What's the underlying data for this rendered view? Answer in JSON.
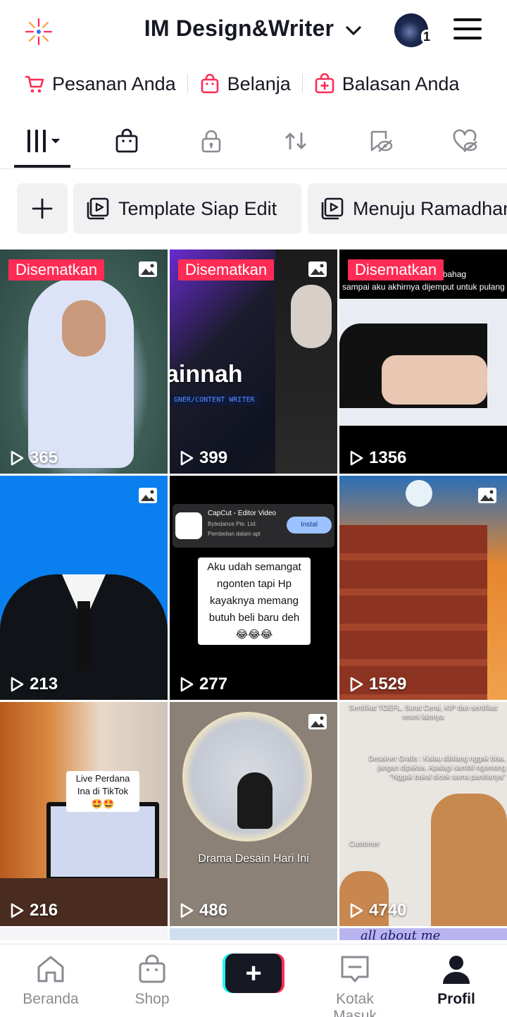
{
  "header": {
    "account_name": "IM Design&Writer",
    "notification_count": "1",
    "icons": [
      "sparkle-icon",
      "chevron-down-icon",
      "avatar",
      "hamburger-menu-icon"
    ]
  },
  "quick_links": [
    {
      "label": "Pesanan Anda",
      "icon": "cart-icon"
    },
    {
      "label": "Belanja",
      "icon": "shopping-bag-icon"
    },
    {
      "label": "Balasan Anda",
      "icon": "add-reply-icon"
    }
  ],
  "tabs": [
    "grid-icon",
    "shop-bag-icon",
    "lock-icon",
    "repost-icon",
    "favorites-icon",
    "liked-icon"
  ],
  "playlists": {
    "add_icon": "plus-icon",
    "items": [
      {
        "label": "Template Siap Edit"
      },
      {
        "label": "Menuju Ramadhan"
      }
    ]
  },
  "grid": {
    "pinned_label": "Disematkan",
    "cells": [
      {
        "views": "365",
        "pinned": true,
        "photo": true
      },
      {
        "views": "399",
        "pinned": true,
        "photo": true,
        "text1": "ainnah",
        "text2": "GNER/CONTENT WRITER"
      },
      {
        "views": "1356",
        "pinned": true,
        "photo": false,
        "text1": "berakhir bahag",
        "text2": "sampai aku akhirnya dijemput untuk pulang"
      },
      {
        "views": "213",
        "pinned": false,
        "photo": true
      },
      {
        "views": "277",
        "pinned": false,
        "photo": false,
        "app_name": "CapCut - Editor Video",
        "app_dev": "Bytedance Pte. Ltd.",
        "app_note": "Pembelian dalam apl",
        "install": "Instal",
        "caption": "Aku udah semangat ngonten tapi Hp kayaknya memang butuh beli baru deh 😂😂😂"
      },
      {
        "views": "1529",
        "pinned": false,
        "photo": true
      },
      {
        "views": "216",
        "pinned": false,
        "photo": false,
        "caption": "Live Perdana Ina di TikTok🤩🤩"
      },
      {
        "views": "486",
        "pinned": false,
        "photo": true,
        "caption": "Drama Desain Hari Ini"
      },
      {
        "views": "4740",
        "pinned": false,
        "photo": false,
        "caption": "Sertifikat TOEFL, Surat Cerai, KtP dan sertifikat resmi lainnya",
        "caption2": "Desainer Grafis : Kalau dibilang nggak bisa, jangan dipaksa. Apalagi sambil ngomong \"Nggak bakal dicek sama panitianya\"",
        "caption3": "Customer"
      }
    ],
    "partial_row_text": "all about me"
  },
  "bottom_nav": [
    {
      "label": "Beranda",
      "icon": "home-icon"
    },
    {
      "label": "Shop",
      "icon": "shop-icon"
    },
    {
      "label": "",
      "icon": "create-plus-icon"
    },
    {
      "label": "Kotak Masuk",
      "icon": "inbox-icon"
    },
    {
      "label": "Profil",
      "icon": "profile-icon"
    }
  ],
  "colors": {
    "accent": "#fe2c55",
    "cyan": "#25f4ee",
    "text": "#161823",
    "muted": "#8a8b91"
  }
}
